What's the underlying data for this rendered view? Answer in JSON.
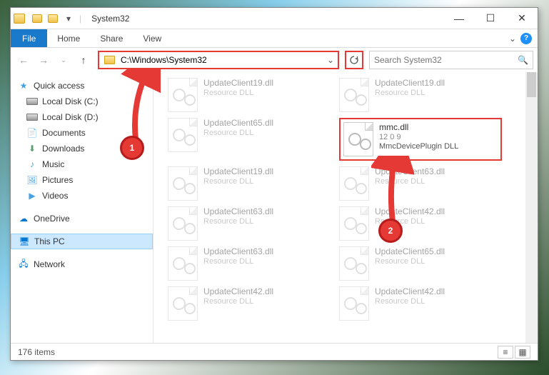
{
  "window": {
    "title": "System32"
  },
  "tabs": {
    "file": "File",
    "home": "Home",
    "share": "Share",
    "view": "View"
  },
  "address": {
    "path": "C:\\Windows\\System32"
  },
  "search": {
    "placeholder": "Search System32"
  },
  "sidebar": {
    "quick_access": "Quick access",
    "local_c": "Local Disk (C:)",
    "local_d": "Local Disk (D:)",
    "documents": "Documents",
    "downloads": "Downloads",
    "music": "Music",
    "pictures": "Pictures",
    "videos": "Videos",
    "onedrive": "OneDrive",
    "this_pc": "This PC",
    "network": "Network"
  },
  "files": {
    "generic_name_19": "UpdateClient19.dll",
    "generic_name_65": "UpdateClient65.dll",
    "generic_name_63": "UpdateClient63.dll",
    "generic_name_42": "UpdateClient42.dll",
    "generic_sub": "Resource DLL",
    "highlight_name": "mmc.dll",
    "highlight_ver": "12 0 9",
    "highlight_desc": "MmcDevicePlugin DLL"
  },
  "status": {
    "count": "176 items"
  },
  "callouts": {
    "c1": "1",
    "c2": "2"
  }
}
